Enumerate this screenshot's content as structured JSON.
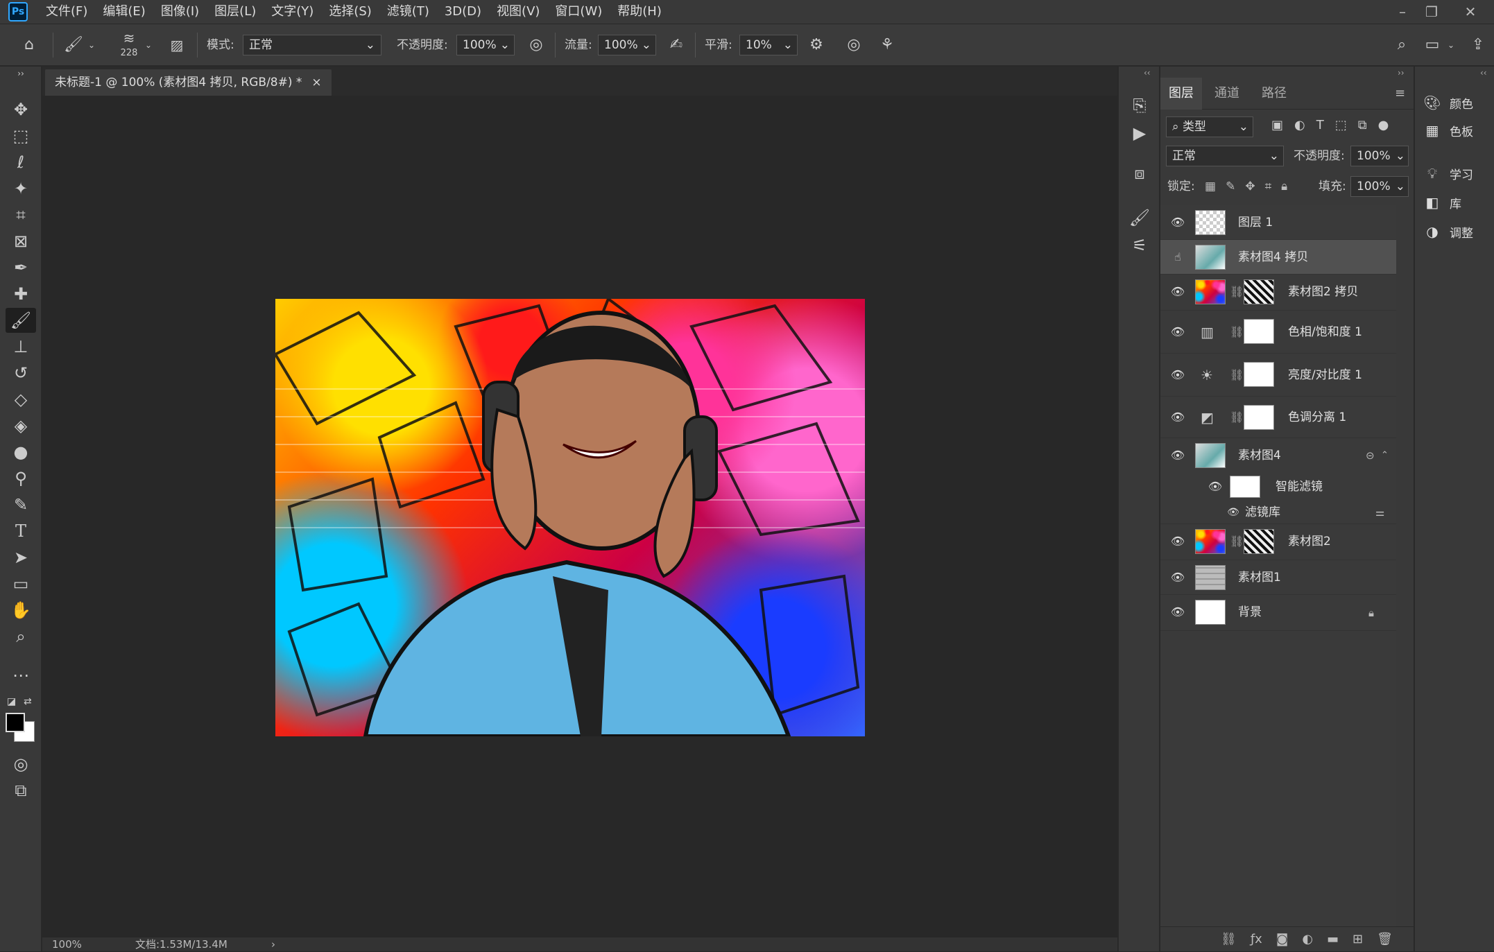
{
  "app": {
    "logo": "Ps"
  },
  "menu": [
    "文件(F)",
    "编辑(E)",
    "图像(I)",
    "图层(L)",
    "文字(Y)",
    "选择(S)",
    "滤镜(T)",
    "3D(D)",
    "视图(V)",
    "窗口(W)",
    "帮助(H)"
  ],
  "options": {
    "brush_size": "228",
    "mode_label": "模式:",
    "mode_value": "正常",
    "opacity_label": "不透明度:",
    "opacity_value": "100%",
    "flow_label": "流量:",
    "flow_value": "100%",
    "smooth_label": "平滑:",
    "smooth_value": "10%"
  },
  "document": {
    "tab_title": "未标题-1 @ 100% (素材图4 拷贝, RGB/8#) *",
    "close": "×",
    "zoom": "100%",
    "doc_info": "文档:1.53M/13.4M",
    "status_arrow": "›"
  },
  "layers_panel": {
    "tabs": [
      "图层",
      "通道",
      "路径"
    ],
    "filter_label": "类型",
    "blend_mode": "正常",
    "opacity_label": "不透明度:",
    "opacity_value": "100%",
    "lock_label": "锁定:",
    "fill_label": "填充:",
    "fill_value": "100%",
    "layers": [
      {
        "name": "图层 1",
        "selected": false
      },
      {
        "name": "素材图4 拷贝",
        "selected": true
      },
      {
        "name": "素材图2 拷贝",
        "selected": false
      },
      {
        "name": "色相/饱和度 1",
        "selected": false
      },
      {
        "name": "亮度/对比度 1",
        "selected": false
      },
      {
        "name": "色调分离 1",
        "selected": false
      },
      {
        "name": "素材图4",
        "selected": false
      },
      {
        "name": "智能滤镜",
        "selected": false
      },
      {
        "name": "滤镜库",
        "selected": false
      },
      {
        "name": "素材图2",
        "selected": false
      },
      {
        "name": "素材图1",
        "selected": false
      },
      {
        "name": "背景",
        "selected": false
      }
    ]
  },
  "right_panel": {
    "items": [
      "颜色",
      "色板",
      "学习",
      "库",
      "调整"
    ]
  },
  "colors": {
    "accent": "#31a8ff",
    "panel": "#393939",
    "canvas": "#282828"
  }
}
